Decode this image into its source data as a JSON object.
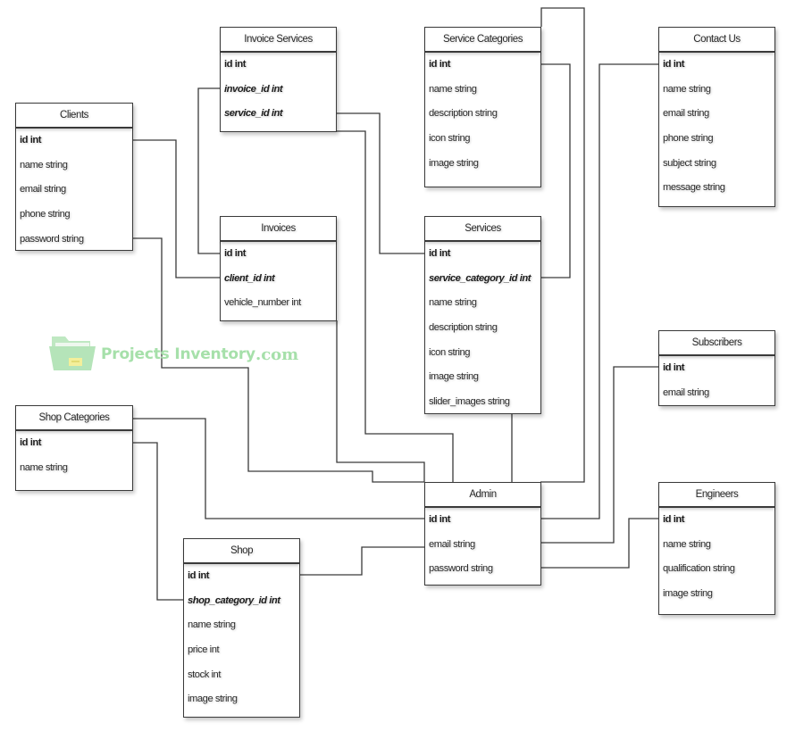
{
  "diagram": {
    "tables": [
      {
        "title": "Invoice Services",
        "fields": [
          {
            "name": "id int",
            "key": "pk"
          },
          {
            "name": "invoice_id int",
            "key": "fk"
          },
          {
            "name": "service_id int",
            "key": "fk"
          }
        ]
      },
      {
        "title": "Clients",
        "fields": [
          {
            "name": "id int",
            "key": "pk"
          },
          {
            "name": "name string",
            "key": ""
          },
          {
            "name": "email string",
            "key": ""
          },
          {
            "name": "phone string",
            "key": ""
          },
          {
            "name": "password string",
            "key": ""
          }
        ]
      },
      {
        "title": "Service Categories",
        "fields": [
          {
            "name": "id int",
            "key": "pk"
          },
          {
            "name": "name string",
            "key": ""
          },
          {
            "name": "description string",
            "key": ""
          },
          {
            "name": "icon string",
            "key": ""
          },
          {
            "name": "image string",
            "key": ""
          }
        ]
      },
      {
        "title": "Contact Us",
        "fields": [
          {
            "name": "id int",
            "key": "pk"
          },
          {
            "name": "name string",
            "key": ""
          },
          {
            "name": "email string",
            "key": ""
          },
          {
            "name": "phone string",
            "key": ""
          },
          {
            "name": "subject string",
            "key": ""
          },
          {
            "name": "message string",
            "key": ""
          }
        ]
      },
      {
        "title": "Invoices",
        "fields": [
          {
            "name": "id int",
            "key": "pk"
          },
          {
            "name": "client_id int",
            "key": "fk"
          },
          {
            "name": "vehicle_number int",
            "key": ""
          }
        ]
      },
      {
        "title": "Services",
        "fields": [
          {
            "name": "id int",
            "key": "pk"
          },
          {
            "name": "service_category_id int",
            "key": "fk"
          },
          {
            "name": "name string",
            "key": ""
          },
          {
            "name": "description string",
            "key": ""
          },
          {
            "name": "icon string",
            "key": ""
          },
          {
            "name": "image string",
            "key": ""
          },
          {
            "name": "slider_images string",
            "key": ""
          }
        ]
      },
      {
        "title": "Subscribers",
        "fields": [
          {
            "name": "id int",
            "key": "pk"
          },
          {
            "name": "email string",
            "key": ""
          }
        ]
      },
      {
        "title": "Shop Categories",
        "fields": [
          {
            "name": "id int",
            "key": "pk"
          },
          {
            "name": "name string",
            "key": ""
          }
        ]
      },
      {
        "title": "Admin",
        "fields": [
          {
            "name": "id int",
            "key": "pk"
          },
          {
            "name": "email string",
            "key": ""
          },
          {
            "name": "password string",
            "key": ""
          }
        ]
      },
      {
        "title": "Engineers",
        "fields": [
          {
            "name": "id int",
            "key": "pk"
          },
          {
            "name": "name string",
            "key": ""
          },
          {
            "name": "qualification string",
            "key": ""
          },
          {
            "name": "image string",
            "key": ""
          }
        ]
      },
      {
        "title": "Shop",
        "fields": [
          {
            "name": "id int",
            "key": "pk"
          },
          {
            "name": "shop_category_id int",
            "key": "fk"
          },
          {
            "name": "name string",
            "key": ""
          },
          {
            "name": "price int",
            "key": ""
          },
          {
            "name": "stock int",
            "key": ""
          },
          {
            "name": "image string",
            "key": ""
          }
        ]
      }
    ]
  },
  "watermark": {
    "icon": "folder-icon",
    "brand": "Projects Inventory",
    "suffix": ".com",
    "color": "#a6e0aa"
  }
}
